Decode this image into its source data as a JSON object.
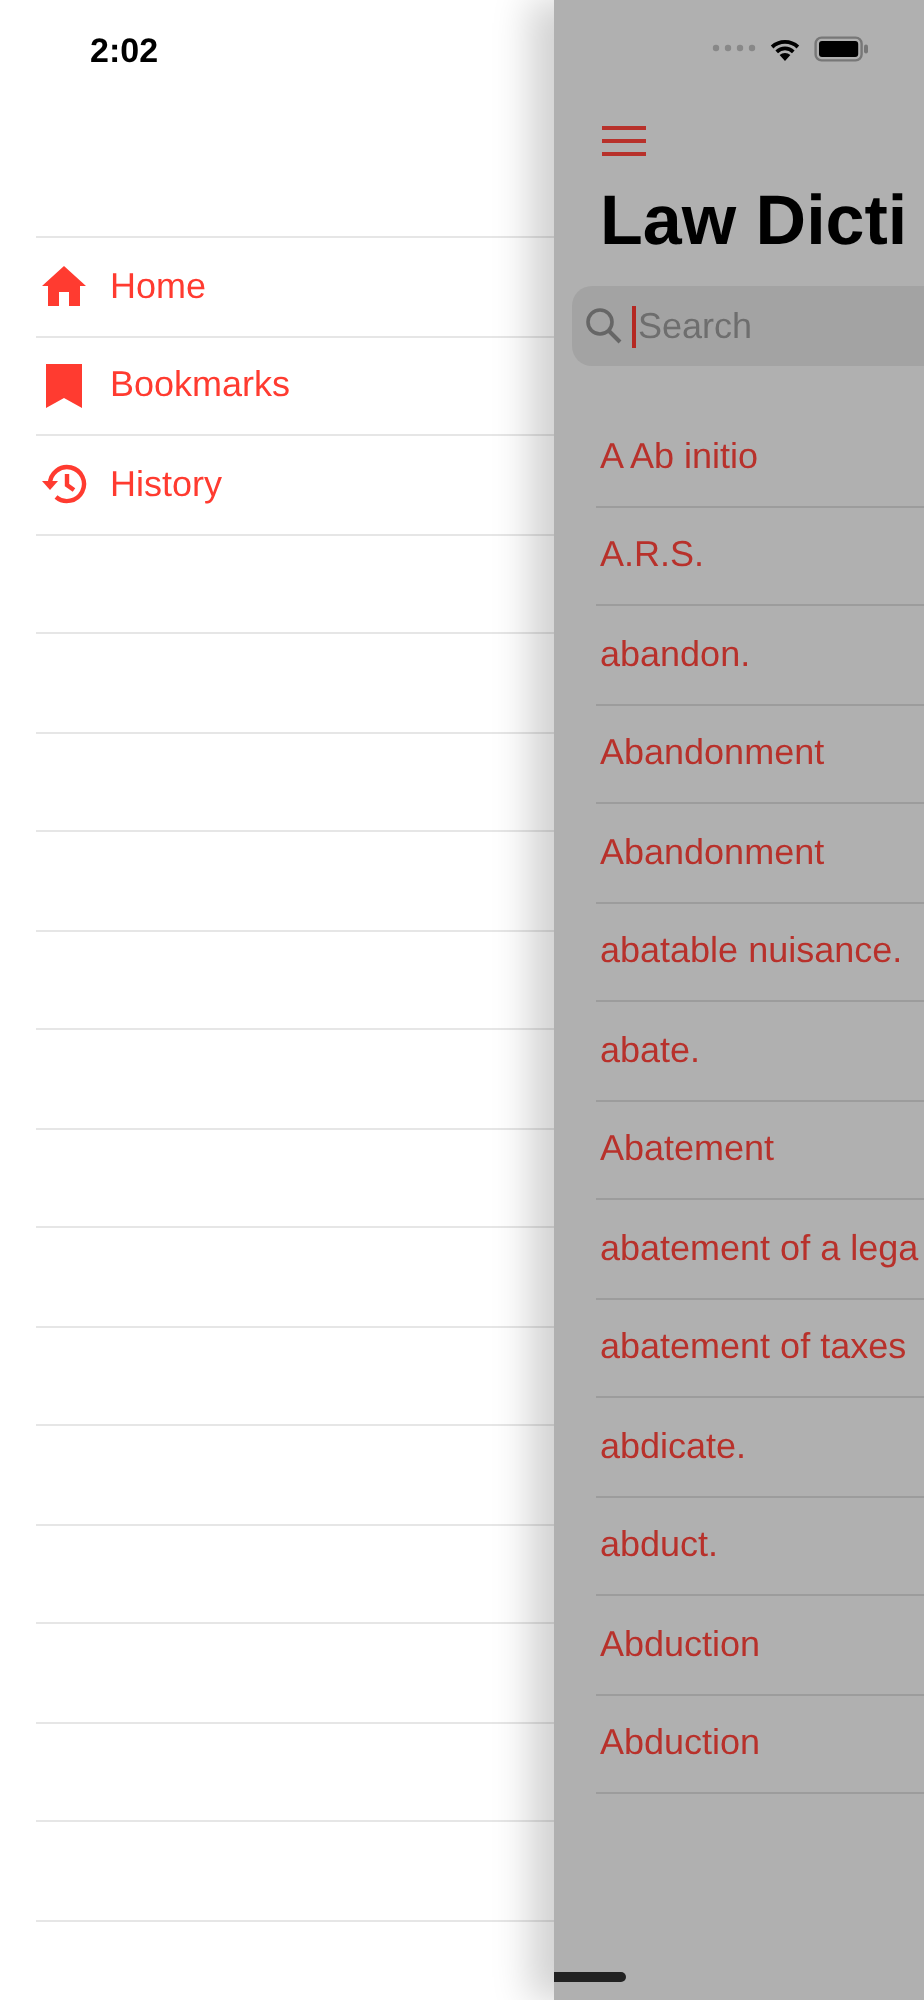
{
  "status_bar": {
    "time": "2:02"
  },
  "menu": {
    "items": [
      {
        "label": "Home",
        "kind": "home"
      },
      {
        "label": "Bookmarks",
        "kind": "bookmark"
      },
      {
        "label": "History",
        "kind": "history"
      }
    ]
  },
  "dictionary": {
    "title": "Law Dicti",
    "search": {
      "placeholder": "Search"
    },
    "entries": [
      "A Ab initio",
      "A.R.S.",
      "abandon.",
      "Abandonment",
      "Abandonment",
      "abatable nuisance.",
      "abate.",
      "Abatement",
      "abatement of a lega",
      "abatement of taxes",
      "abdicate.",
      "abduct.",
      "Abduction",
      "Abduction"
    ]
  }
}
